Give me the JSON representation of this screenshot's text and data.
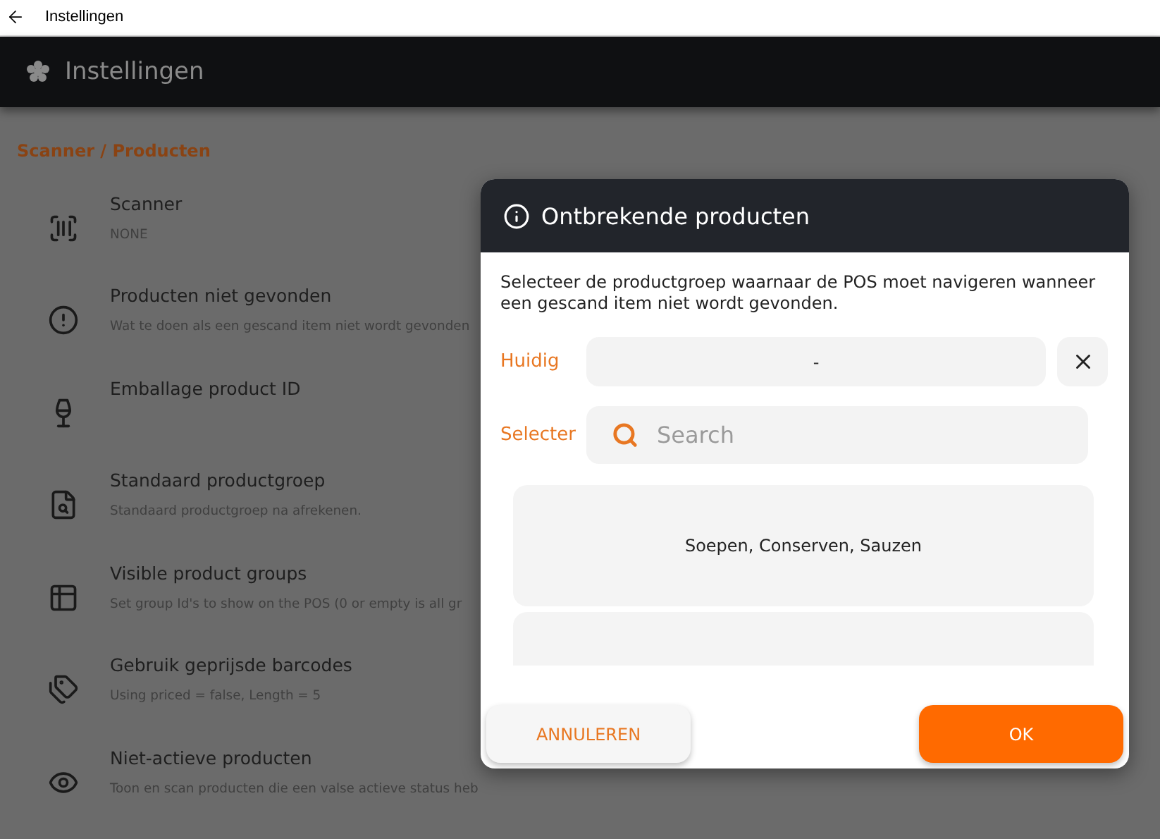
{
  "window": {
    "title": "Instellingen"
  },
  "app_bar": {
    "title": "Instellingen"
  },
  "section_title": "Scanner / Producten",
  "settings": [
    {
      "title": "Scanner",
      "subtitle": "NONE"
    },
    {
      "title": "Producten niet gevonden",
      "subtitle": "Wat te doen als een gescand item niet wordt gevonden"
    },
    {
      "title": "Emballage product ID"
    },
    {
      "title": "Standaard productgroep",
      "subtitle": "Standaard productgroep na afrekenen."
    },
    {
      "title": "Visible product groups",
      "subtitle": "Set group Id's to show on the POS (0 or empty is all gr"
    },
    {
      "title": "Gebruik geprijsde barcodes",
      "subtitle": "Using priced = false, Length = 5"
    },
    {
      "title": "Niet-actieve producten",
      "subtitle": "Toon en scan producten die een valse actieve status heb"
    }
  ],
  "dialog": {
    "title": "Ontbrekende producten",
    "description": "Selecteer de productgroep waarnaar de POS moet navigeren wanneer een gescand item niet wordt gevonden.",
    "current_label": "Huidig",
    "current_value": "-",
    "select_label": "Selecter",
    "search": {
      "placeholder": "Search"
    },
    "items": [
      {
        "label": "Soepen, Conserven, Sauzen"
      }
    ],
    "buttons": [
      {
        "label": "ANNULEREN",
        "kind": "secondary"
      },
      {
        "label": "OK",
        "kind": "primary"
      }
    ]
  }
}
